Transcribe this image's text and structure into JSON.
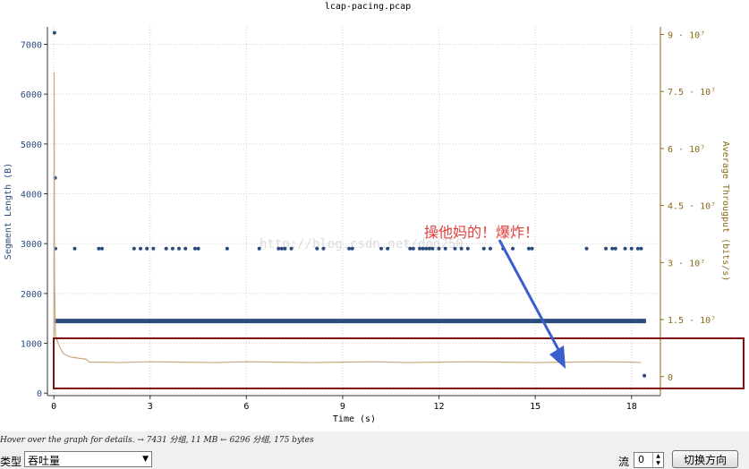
{
  "chart_data": {
    "type": "scatter",
    "title": "lcap-pacing.pcap",
    "xlabel": "Time (s)",
    "ylabel": "Segment Length (B)",
    "y2label": "Average Througput (bits/s)",
    "xlim": [
      -0.2,
      18.9
    ],
    "ylim": [
      -50,
      7350
    ],
    "y2lim": [
      -5000000.0,
      92000000.0
    ],
    "x_ticks": [
      0,
      3,
      6,
      9,
      12,
      15,
      18
    ],
    "x_tick_labels": [
      "0",
      "3",
      "6",
      "9",
      "12",
      "15",
      "18"
    ],
    "y_ticks": [
      0,
      1000,
      2000,
      3000,
      4000,
      5000,
      6000,
      7000
    ],
    "y_tick_labels": [
      "0",
      "1000",
      "2000",
      "3000",
      "4000",
      "5000",
      "6000",
      "7000"
    ],
    "y2_ticks": [
      0,
      15000000.0,
      30000000.0,
      45000000.0,
      60000000.0,
      75000000.0,
      90000000.0
    ],
    "y2_tick_labels": [
      "0",
      "1.5 · 10⁷",
      "3 · 10⁷",
      "4.5 · 10⁷",
      "6 · 10⁷",
      "7.5 · 10⁷",
      "9 · 10⁷"
    ],
    "grid": true,
    "series": [
      {
        "values_note": "",
        "color": "#2a4b7c",
        "kind": "points",
        "x": [
          0.02,
          0.04,
          0.05,
          0.05,
          0.65,
          1.4,
          1.5,
          2.5,
          2.7,
          2.9,
          3.1,
          3.5,
          3.7,
          3.9,
          4.1,
          4.4,
          4.5,
          5.4,
          6.4,
          7.0,
          7.1,
          7.2,
          7.4,
          8.2,
          8.4,
          9.2,
          9.3,
          10.2,
          10.4,
          11.1,
          11.2,
          11.4,
          11.5,
          11.6,
          11.7,
          11.8,
          12.0,
          12.2,
          12.5,
          12.7,
          12.9,
          13.4,
          13.6,
          14.0,
          14.3,
          14.8,
          14.9,
          16.6,
          17.2,
          17.4,
          17.5,
          17.8,
          18.0,
          18.2,
          18.3,
          18.4
        ],
        "y": [
          7230,
          4320,
          2900,
          1440,
          2900,
          2900,
          2900,
          2900,
          2900,
          2900,
          2900,
          2900,
          2900,
          2900,
          2900,
          2900,
          2900,
          2900,
          2900,
          2900,
          2900,
          2900,
          2900,
          2900,
          2900,
          2900,
          2900,
          2900,
          2900,
          2900,
          2900,
          2900,
          2900,
          2900,
          2900,
          2900,
          2900,
          2900,
          2900,
          2900,
          2900,
          2900,
          2900,
          2900,
          2900,
          2900,
          2900,
          2900,
          2900,
          2900,
          2900,
          2900,
          2900,
          2900,
          2900,
          350
        ]
      },
      {
        "color": "#2a4b7c",
        "kind": "band",
        "x": [
          0,
          18.45
        ],
        "y": [
          1448,
          1448
        ]
      },
      {
        "color": "#c8a882",
        "kind": "line",
        "axis": "y2",
        "x": [
          0,
          0.01,
          0.02,
          0.05,
          0.1,
          0.2,
          0.3,
          0.5,
          0.8,
          1.0,
          1.1,
          1.5,
          2.0,
          3.0,
          4.0,
          5.0,
          6.0,
          7.0,
          8.0,
          9.0,
          10.0,
          11.0,
          12.0,
          13.0,
          14.0,
          15.0,
          16.0,
          17.0,
          18.0,
          18.3
        ],
        "y": [
          0,
          80000000.0,
          26000000.0,
          11000000.0,
          9500000.0,
          7500000.0,
          6000000.0,
          5200000.0,
          4800000.0,
          4600000.0,
          3800000.0,
          3800000.0,
          3700000.0,
          3900000.0,
          3800000.0,
          3700000.0,
          3900000.0,
          3800000.0,
          3700000.0,
          3800000.0,
          3900000.0,
          3700000.0,
          3800000.0,
          3900000.0,
          3800000.0,
          3700000.0,
          3800000.0,
          3900000.0,
          3800000.0,
          3700000.0
        ]
      }
    ],
    "annotation": {
      "text": "操他妈的！爆炸！",
      "color": "#e03c3c",
      "arrow_color": "#3a5fcd",
      "box_color": "#7a1010",
      "watermark": "http://blog.csdn.net/dog250"
    }
  },
  "status": {
    "hint": "Hover over the graph for details. → 7431 分组, 11 MB ← 6296 分组, 175 bytes"
  },
  "controls": {
    "type_label": "类型",
    "type_value": "吞吐量",
    "flow_label": "流",
    "flow_value": "0",
    "switch_button": "切换方向"
  }
}
